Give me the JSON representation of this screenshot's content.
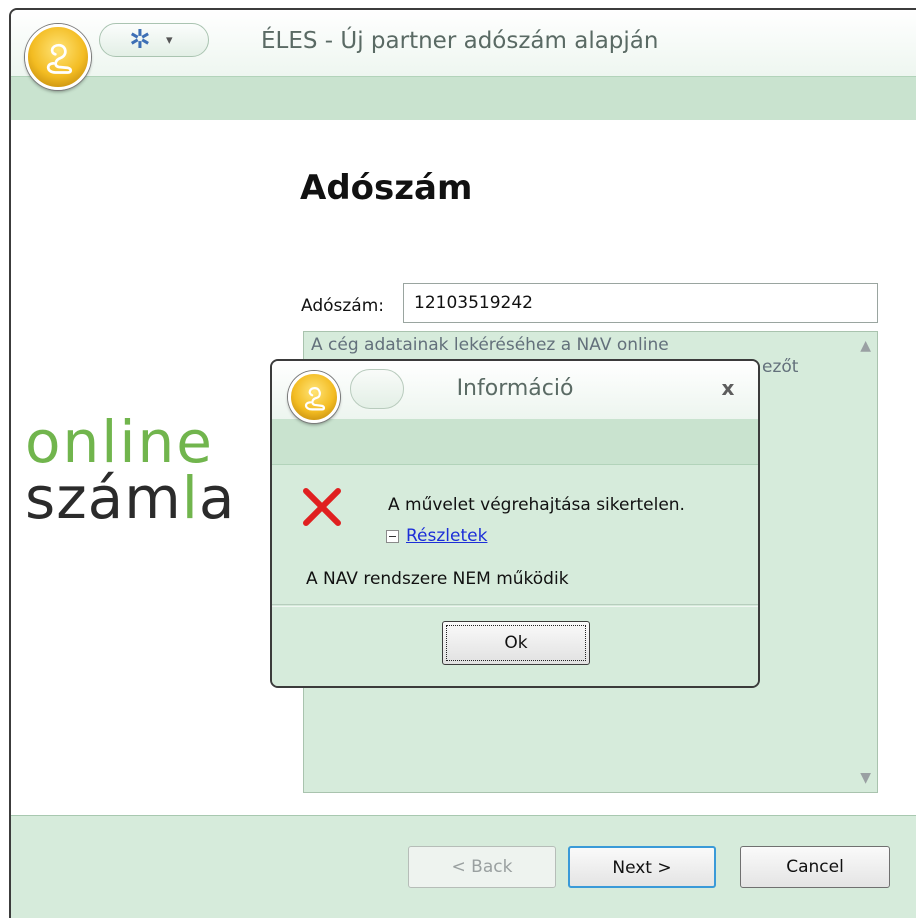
{
  "window": {
    "title": "ÉLES - Új partner adószám alapján",
    "quick_access_arrow": "▾"
  },
  "page": {
    "heading": "Adószám",
    "tax_number_label": "Adószám:",
    "tax_number_value": "12103519242",
    "info_text_line1": "A cég adatainak lekéréséhez a NAV online",
    "info_text_line2_fragment": "ezőt",
    "scroll_up": "▲",
    "scroll_down": "▼"
  },
  "logo": {
    "line1": "online",
    "line2_prefix": "szám",
    "line2_green": "l",
    "line2_suffix": "a"
  },
  "footer": {
    "back_label": "< Back",
    "next_label": "Next >",
    "cancel_label": "Cancel"
  },
  "dialog": {
    "title": "Információ",
    "close_label": "x",
    "error_message": "A művelet végrehajtása sikertelen.",
    "details_label": "Részletek",
    "nav_message": "A NAV rendszere NEM működik",
    "ok_label": "Ok"
  },
  "colors": {
    "window_background": "#d6ebdb",
    "ribbon": "#c9e3cf",
    "logo_green": "#71b54d",
    "error_red": "#e02020",
    "link_blue": "#1c2ed8"
  },
  "icons": {
    "app_orb": "cobra-orb-icon",
    "settings": "gear-icon",
    "error": "error-x-icon",
    "details_toggle": "collapse-minus-icon"
  }
}
